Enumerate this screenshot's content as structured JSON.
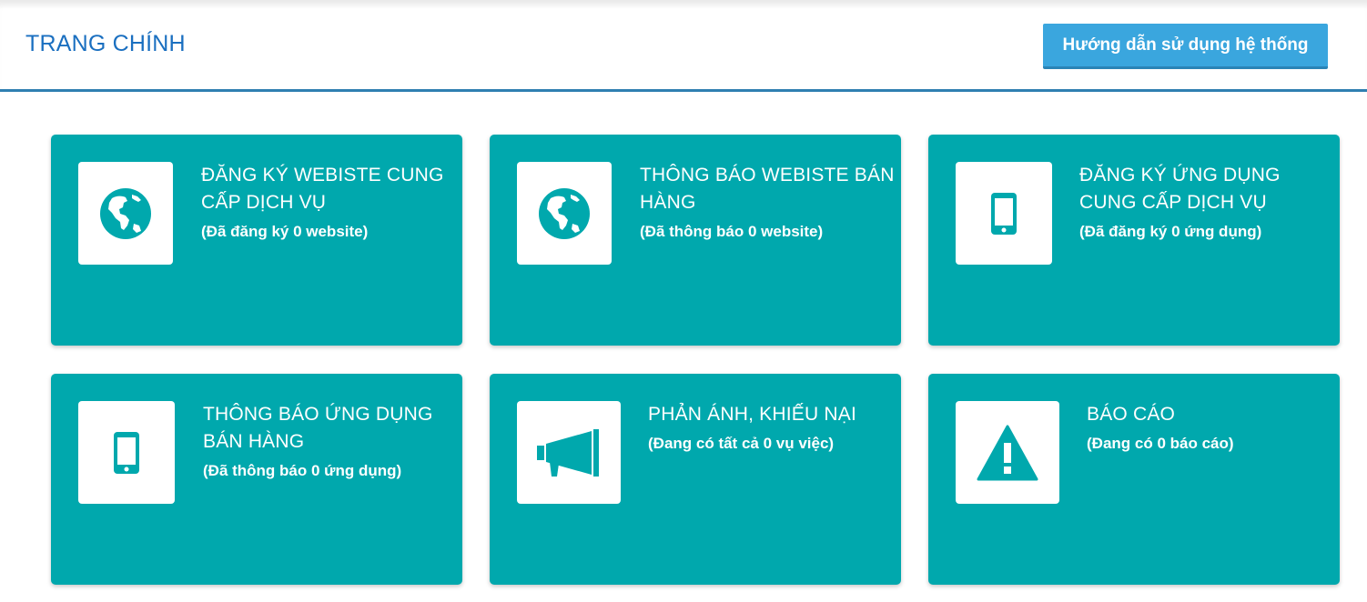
{
  "header": {
    "title": "TRANG CHÍNH",
    "guide_button_label": "Hướng dẫn sử dụng hệ thống"
  },
  "colors": {
    "accent": "#1a6fc0",
    "card_background": "#00a8ad",
    "button_background": "#3aa6de",
    "header_border": "#2f7fb1"
  },
  "cards": [
    {
      "title": "ĐĂNG KÝ WEBISTE CUNG CẤP DỊCH VỤ",
      "subtitle": "(Đã đăng ký 0 website)",
      "icon": "globe-icon"
    },
    {
      "title": "THÔNG BÁO WEBISTE BÁN HÀNG",
      "subtitle": "(Đã thông báo 0 website)",
      "icon": "globe-icon"
    },
    {
      "title": "ĐĂNG KÝ ỨNG DỤNG CUNG CẤP DỊCH VỤ",
      "subtitle": "(Đã đăng ký 0 ứng dụng)",
      "icon": "mobile-phone-icon"
    },
    {
      "title": "THÔNG BÁO ỨNG DỤNG BÁN HÀNG",
      "subtitle": "(Đã thông báo 0 ứng dụng)",
      "icon": "mobile-phone-icon"
    },
    {
      "title": "PHẢN ÁNH, KHIẾU NẠI",
      "subtitle": "(Đang có tất cả 0 vụ việc)",
      "icon": "megaphone-icon"
    },
    {
      "title": "BÁO CÁO",
      "subtitle": "(Đang có 0 báo cáo)",
      "icon": "warning-icon"
    }
  ]
}
